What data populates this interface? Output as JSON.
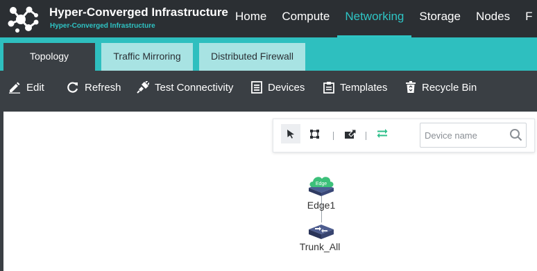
{
  "header": {
    "title": "Hyper-Converged Infrastructure",
    "subtitle": "Hyper-Converged Infrastructure",
    "logo_icon": "molecule-network-icon",
    "nav": [
      {
        "label": "Home",
        "active": false
      },
      {
        "label": "Compute",
        "active": false
      },
      {
        "label": "Networking",
        "active": true
      },
      {
        "label": "Storage",
        "active": false
      },
      {
        "label": "Nodes",
        "active": false
      },
      {
        "label": "F",
        "active": false
      }
    ]
  },
  "tabs": [
    {
      "label": "Topology",
      "active": true
    },
    {
      "label": "Traffic Mirroring",
      "active": false
    },
    {
      "label": "Distributed Firewall",
      "active": false
    }
  ],
  "toolbar": {
    "edit": "Edit",
    "refresh": "Refresh",
    "test_connectivity": "Test Connectivity",
    "devices": "Devices",
    "templates": "Templates",
    "recycle_bin": "Recycle Bin"
  },
  "topology_panel": {
    "tools": [
      "select-pointer-icon",
      "box-select-icon",
      "export-icon",
      "swap-arrows-icon"
    ],
    "search_placeholder": "Device name"
  },
  "nodes": [
    {
      "label": "Edge1",
      "badge": "Edge",
      "type": "edge-router"
    },
    {
      "label": "Trunk_All",
      "type": "switch"
    }
  ],
  "colors": {
    "accent": "#2ec4c4",
    "header_bg": "#2b2f33",
    "toolbar_bg": "#3a3f44",
    "edge_green": "#3cc07a",
    "switch_navy": "#3d4a78"
  }
}
